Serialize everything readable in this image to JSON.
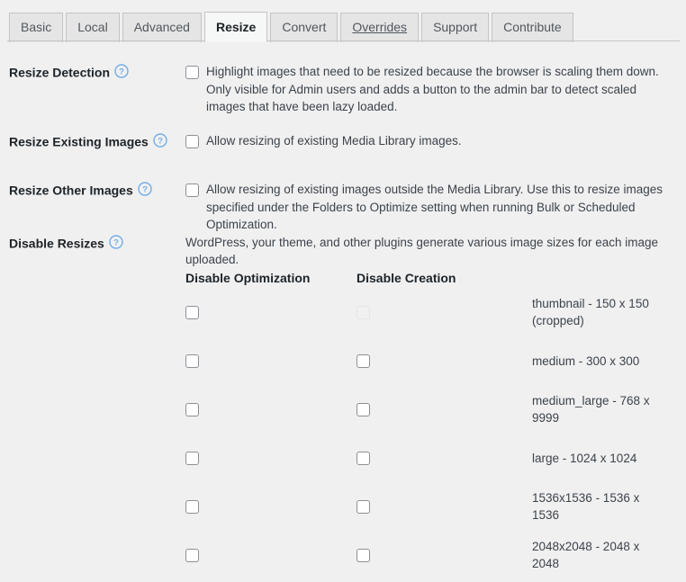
{
  "tabs": [
    {
      "label": "Basic",
      "active": false,
      "underlined": false
    },
    {
      "label": "Local",
      "active": false,
      "underlined": false
    },
    {
      "label": "Advanced",
      "active": false,
      "underlined": false
    },
    {
      "label": "Resize",
      "active": true,
      "underlined": false
    },
    {
      "label": "Convert",
      "active": false,
      "underlined": false
    },
    {
      "label": "Overrides",
      "active": false,
      "underlined": true
    },
    {
      "label": "Support",
      "active": false,
      "underlined": false
    },
    {
      "label": "Contribute",
      "active": false,
      "underlined": false
    }
  ],
  "settings": {
    "resize_detection": {
      "label": "Resize Detection",
      "help_icon": "help-circle-icon",
      "checkbox_checked": false,
      "description": "Highlight images that need to be resized because the browser is scaling them down. Only visible for Admin users and adds a button to the admin bar to detect scaled images that have been lazy loaded."
    },
    "resize_existing_images": {
      "label": "Resize Existing Images",
      "help_icon": "help-circle-icon",
      "checkbox_checked": false,
      "description": "Allow resizing of existing Media Library images."
    },
    "resize_other_images": {
      "label": "Resize Other Images",
      "help_icon": "help-circle-icon",
      "checkbox_checked": false,
      "description": "Allow resizing of existing images outside the Media Library. Use this to resize images specified under the Folders to Optimize setting when running Bulk or Scheduled Optimization."
    },
    "disable_resizes": {
      "label": "Disable Resizes",
      "help_icon": "help-circle-icon",
      "description": "WordPress, your theme, and other plugins generate various image sizes for each image uploaded.",
      "columns": {
        "optimization": "Disable Optimization",
        "creation": "Disable Creation"
      },
      "rows": [
        {
          "name": "thumbnail - 150 x 150 (cropped)",
          "disable_optimization": false,
          "disable_creation": false,
          "creation_disabled_control": true
        },
        {
          "name": "medium - 300 x 300",
          "disable_optimization": false,
          "disable_creation": false,
          "creation_disabled_control": false
        },
        {
          "name": "medium_large - 768 x 9999",
          "disable_optimization": false,
          "disable_creation": false,
          "creation_disabled_control": false
        },
        {
          "name": "large - 1024 x 1024",
          "disable_optimization": false,
          "disable_creation": false,
          "creation_disabled_control": false
        },
        {
          "name": "1536x1536 - 1536 x 1536",
          "disable_optimization": false,
          "disable_creation": false,
          "creation_disabled_control": false
        },
        {
          "name": "2048x2048 - 2048 x 2048",
          "disable_optimization": false,
          "disable_creation": false,
          "creation_disabled_control": false
        }
      ]
    }
  },
  "colors": {
    "page_background": "#f0f0f1",
    "tab_inactive_background": "#e5e5e5",
    "tab_active_background": "#f6f7f7",
    "border": "#c3c4c7",
    "help_icon": "#72aee6",
    "text": "#3c434a",
    "heading_text": "#1d2327"
  }
}
